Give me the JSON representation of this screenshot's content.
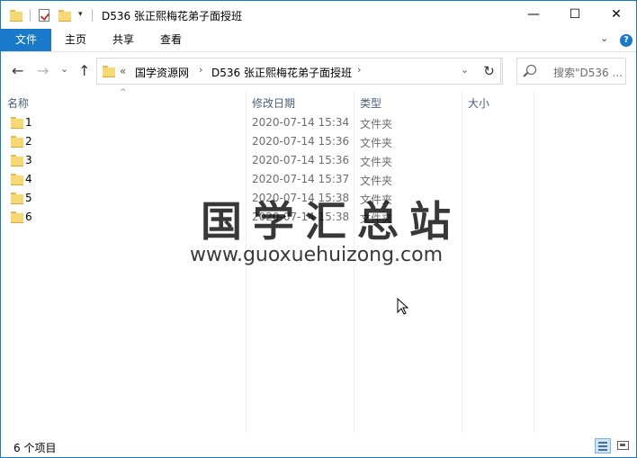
{
  "window": {
    "title": "D536 张正熙梅花弟子面授班",
    "controls": {
      "minimize": "—",
      "maximize": "☐",
      "close": "✕"
    }
  },
  "quick_access": {
    "dropdown": "▾"
  },
  "ribbon": {
    "tabs": [
      "文件",
      "主页",
      "共享",
      "查看"
    ],
    "expand_chevron": "⌄",
    "help": "?"
  },
  "nav": {
    "back": "←",
    "forward": "→",
    "recent": "⌄",
    "up": "↑",
    "breadcrumb_overflow": "«",
    "breadcrumb": [
      "国学资源网",
      "D536 张正熙梅花弟子面授班"
    ],
    "breadcrumb_sep": "›",
    "address_dropdown": "⌄",
    "refresh": "↻",
    "search_placeholder": "搜索\"D536 ..."
  },
  "columns": {
    "name": "名称",
    "date": "修改日期",
    "type": "类型",
    "size": "大小",
    "sort_arrow": "^"
  },
  "files": [
    {
      "name": "1",
      "date": "2020-07-14 15:34",
      "type": "文件夹",
      "size": ""
    },
    {
      "name": "2",
      "date": "2020-07-14 15:36",
      "type": "文件夹",
      "size": ""
    },
    {
      "name": "3",
      "date": "2020-07-14 15:36",
      "type": "文件夹",
      "size": ""
    },
    {
      "name": "4",
      "date": "2020-07-14 15:37",
      "type": "文件夹",
      "size": ""
    },
    {
      "name": "5",
      "date": "2020-07-14 15:38",
      "type": "文件夹",
      "size": ""
    },
    {
      "name": "6",
      "date": "2020-07-14 15:38",
      "type": "文件夹",
      "size": ""
    }
  ],
  "watermark": {
    "cn": "国学汇总站",
    "en": "www.guoxuehuizong.com"
  },
  "status": {
    "item_count": "6 个项目"
  },
  "colors": {
    "accent": "#1979ca",
    "folder": "#f8d775",
    "header_text": "#4c607a"
  },
  "icons": [
    "folder-icon",
    "properties-check-icon",
    "back-arrow-icon",
    "forward-arrow-icon",
    "up-arrow-icon",
    "refresh-icon",
    "search-icon",
    "help-icon",
    "details-view-icon",
    "tiles-view-icon",
    "cursor-icon"
  ]
}
